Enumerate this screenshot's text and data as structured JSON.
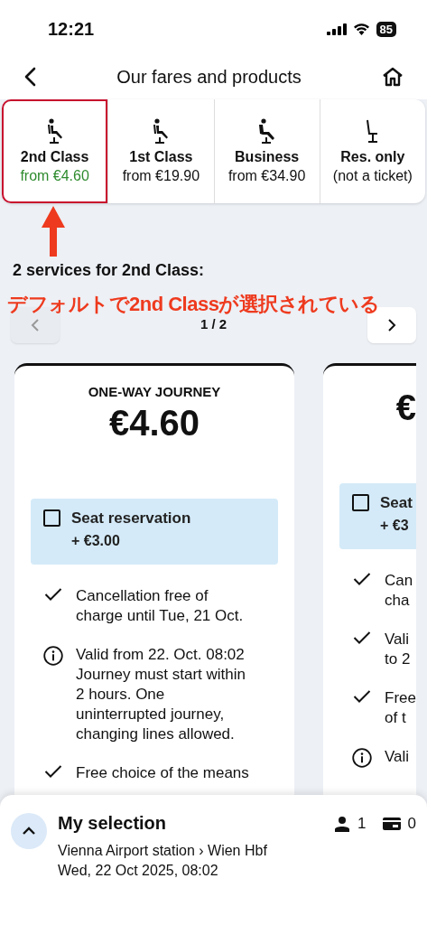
{
  "status_bar": {
    "time": "12:21",
    "battery": "85"
  },
  "header": {
    "title": "Our fares and products"
  },
  "classes": [
    {
      "label": "2nd Class",
      "price": "from €4.60",
      "selected": true,
      "kind": "standard"
    },
    {
      "label": "1st Class",
      "price": "from €19.90",
      "selected": false,
      "kind": "standard"
    },
    {
      "label": "Business",
      "price": "from €34.90",
      "selected": false,
      "kind": "premium"
    },
    {
      "label": "Res. only",
      "price": "(not a ticket)",
      "selected": false,
      "kind": "empty"
    }
  ],
  "services_heading": "2 services for 2nd Class:",
  "pager": {
    "label": "1 / 2",
    "prev_disabled": true,
    "next_disabled": false
  },
  "cards": [
    {
      "title": "ONE-WAY JOURNEY",
      "price": "€4.60",
      "addon": {
        "label": "Seat reservation",
        "price": "+ €3.00",
        "checked": false
      },
      "features": [
        {
          "kind": "check",
          "lines": [
            "Cancellation free of",
            "charge until Tue, 21 Oct."
          ]
        },
        {
          "kind": "info",
          "lines": [
            "Valid from 22. Oct. 08:02",
            "Journey must start within",
            "2 hours. One",
            "uninterrupted journey,",
            "changing lines allowed."
          ]
        },
        {
          "kind": "check",
          "lines": [
            "Free choice of the means"
          ]
        }
      ]
    },
    {
      "price": "€",
      "addon": {
        "label": "Seat",
        "price": "+ €3",
        "checked": false
      },
      "features": [
        {
          "kind": "check",
          "lines": [
            "Can",
            "cha"
          ]
        },
        {
          "kind": "check",
          "lines": [
            "Vali",
            "to 2"
          ]
        },
        {
          "kind": "check",
          "lines": [
            "Free",
            "of t"
          ]
        },
        {
          "kind": "info",
          "lines": [
            "Vali"
          ]
        }
      ]
    }
  ],
  "selection": {
    "title": "My selection",
    "route": "Vienna Airport station › Wien Hbf",
    "date": "Wed, 22 Oct 2025, 08:02",
    "passengers": "1",
    "discount_cards": "0",
    "expanded": false
  },
  "annotation": {
    "kind": "arrow",
    "text": "デフォルトで2nd Classが選択されている"
  }
}
